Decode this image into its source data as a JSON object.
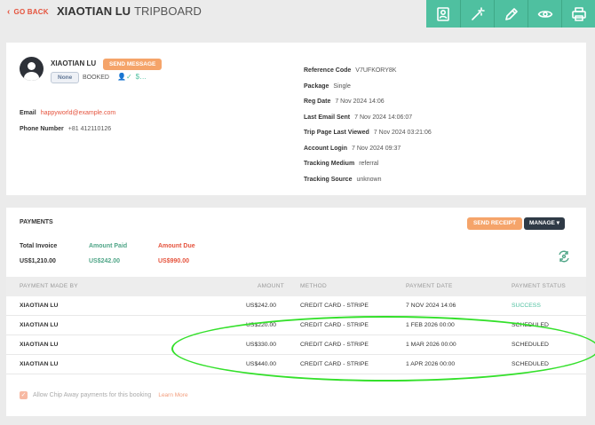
{
  "header": {
    "back_label": "GO BACK",
    "name": "XIAOTIAN LU",
    "subtitle": "TRIPBOARD",
    "tools": [
      "profile-icon",
      "magic-wand-icon",
      "pencil-icon",
      "eye-icon",
      "print-icon"
    ]
  },
  "customer": {
    "name": "XIAOTIAN LU",
    "send_message_label": "SEND MESSAGE",
    "badge": "None",
    "status": "BOOKED",
    "email_label": "Email",
    "email": "happyworld@example.com",
    "phone_label": "Phone Number",
    "phone": "+81 412110126"
  },
  "meta": [
    {
      "label": "Reference Code",
      "value": "V7UFKORY8K"
    },
    {
      "label": "Package",
      "value": "Single"
    },
    {
      "label": "Reg Date",
      "value": "7 Nov 2024 14:06"
    },
    {
      "label": "Last Email Sent",
      "value": "7 Nov 2024 14:06:07"
    },
    {
      "label": "Trip Page Last Viewed",
      "value": "7 Nov 2024 03:21:06"
    },
    {
      "label": "Account Login",
      "value": "7 Nov 2024 09:37"
    },
    {
      "label": "Tracking Medium",
      "value": "referral"
    },
    {
      "label": "Tracking Source",
      "value": "unknown"
    }
  ],
  "payments": {
    "title": "PAYMENTS",
    "send_receipt_label": "SEND RECEIPT",
    "manage_label": "MANAGE ▾",
    "total_invoice_label": "Total Invoice",
    "total_invoice": "US$1,210.00",
    "amount_paid_label": "Amount Paid",
    "amount_paid": "US$242.00",
    "amount_due_label": "Amount Due",
    "amount_due": "US$990.00",
    "columns": [
      "PAYMENT MADE BY",
      "AMOUNT",
      "METHOD",
      "PAYMENT DATE",
      "PAYMENT STATUS"
    ],
    "rows": [
      {
        "by": "XIAOTIAN LU",
        "amount": "US$242.00",
        "method": "CREDIT CARD - STRIPE",
        "date": "7 NOV 2024 14:06",
        "status": "SUCCESS"
      },
      {
        "by": "XIAOTIAN LU",
        "amount": "US$220.00",
        "method": "CREDIT CARD - STRIPE",
        "date": "1 FEB 2026 00:00",
        "status": "SCHEDULED"
      },
      {
        "by": "XIAOTIAN LU",
        "amount": "US$330.00",
        "method": "CREDIT CARD - STRIPE",
        "date": "1 MAR 2026 00:00",
        "status": "SCHEDULED"
      },
      {
        "by": "XIAOTIAN LU",
        "amount": "US$440.00",
        "method": "CREDIT CARD - STRIPE",
        "date": "1 APR 2026 00:00",
        "status": "SCHEDULED"
      }
    ],
    "chip_away_label": "Allow Chip Away payments for this booking",
    "learn_more": "Learn More"
  },
  "colors": {
    "accent_teal": "#4fc0a0",
    "accent_orange": "#f5a46a",
    "danger": "#e5533d",
    "highlight_ellipse": "#33e02a"
  }
}
